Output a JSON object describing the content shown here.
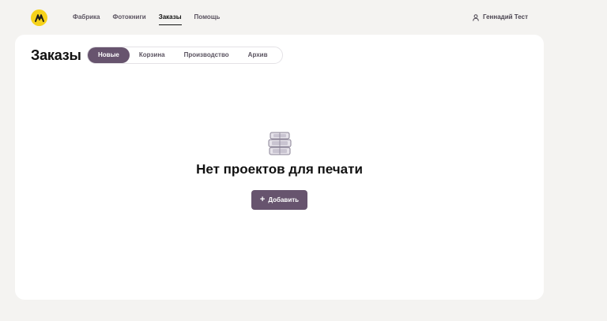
{
  "nav": {
    "items": [
      {
        "label": "Фабрика",
        "active": false
      },
      {
        "label": "Фотокниги",
        "active": false
      },
      {
        "label": "Заказы",
        "active": true
      },
      {
        "label": "Помощь",
        "active": false
      }
    ],
    "user_name": "Геннадий Тест"
  },
  "page": {
    "title": "Заказы",
    "tabs": [
      {
        "label": "Новые",
        "active": true
      },
      {
        "label": "Корзина",
        "active": false
      },
      {
        "label": "Производство",
        "active": false
      },
      {
        "label": "Архив",
        "active": false
      }
    ]
  },
  "empty_state": {
    "icon": "stacked-books-icon",
    "title": "Нет проектов для печати",
    "button_label": "Добавить"
  },
  "colors": {
    "accent": "#67546e",
    "logo": "#f6d21a",
    "background": "#f4f3f1",
    "card": "#ffffff"
  }
}
